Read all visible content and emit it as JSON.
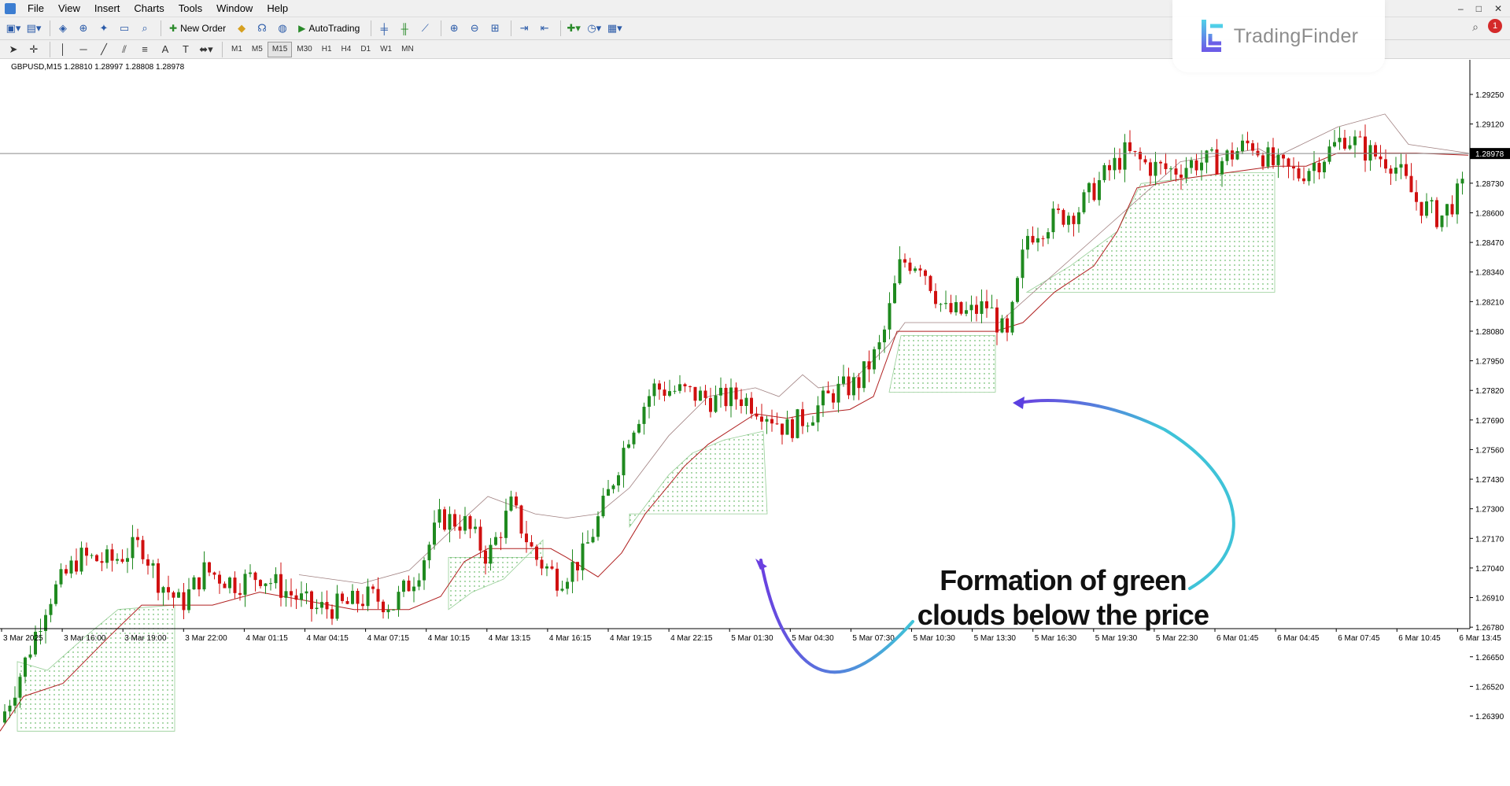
{
  "menu": {
    "items": [
      "File",
      "View",
      "Insert",
      "Charts",
      "Tools",
      "Window",
      "Help"
    ],
    "window_controls": [
      "‒",
      "□",
      "✕"
    ]
  },
  "toolbar": {
    "new_order_label": "New Order",
    "autotrading_label": "AutoTrading",
    "timeframes": [
      "M1",
      "M5",
      "M15",
      "M30",
      "H1",
      "H4",
      "D1",
      "W1",
      "MN"
    ],
    "active_timeframe": "M15",
    "notification_count": "1"
  },
  "chart": {
    "header": "GBPUSD,M15  1.28810 1.28997 1.28808 1.28978",
    "current_price": "1.28978",
    "price_labels": [
      "1.29250",
      "1.29120",
      "1.28860",
      "1.28730",
      "1.28600",
      "1.28470",
      "1.28340",
      "1.28210",
      "1.28080",
      "1.27950",
      "1.27820",
      "1.27690",
      "1.27560",
      "1.27430",
      "1.27300",
      "1.27170",
      "1.27040",
      "1.26910",
      "1.26780",
      "1.26650",
      "1.26520",
      "1.26390"
    ],
    "time_labels": [
      "3 Mar 2025",
      "3 Mar 16:00",
      "3 Mar 19:00",
      "3 Mar 22:00",
      "4 Mar 01:15",
      "4 Mar 04:15",
      "4 Mar 07:15",
      "4 Mar 10:15",
      "4 Mar 13:15",
      "4 Mar 16:15",
      "4 Mar 19:15",
      "4 Mar 22:15",
      "5 Mar 01:30",
      "5 Mar 04:30",
      "5 Mar 07:30",
      "5 Mar 10:30",
      "5 Mar 13:30",
      "5 Mar 16:30",
      "5 Mar 19:30",
      "5 Mar 22:30",
      "6 Mar 01:45",
      "6 Mar 04:45",
      "6 Mar 07:45",
      "6 Mar 10:45",
      "6 Mar 13:45"
    ],
    "colors": {
      "bull": "#1f8a1f",
      "bear": "#d01010",
      "cloud": "#2e9e2e",
      "line_red": "#b02020",
      "line_gray": "#a08080"
    }
  },
  "logo": {
    "text": "TradingFinder"
  },
  "annotation": {
    "line1": "Formation of green",
    "line2": "clouds below the price"
  }
}
